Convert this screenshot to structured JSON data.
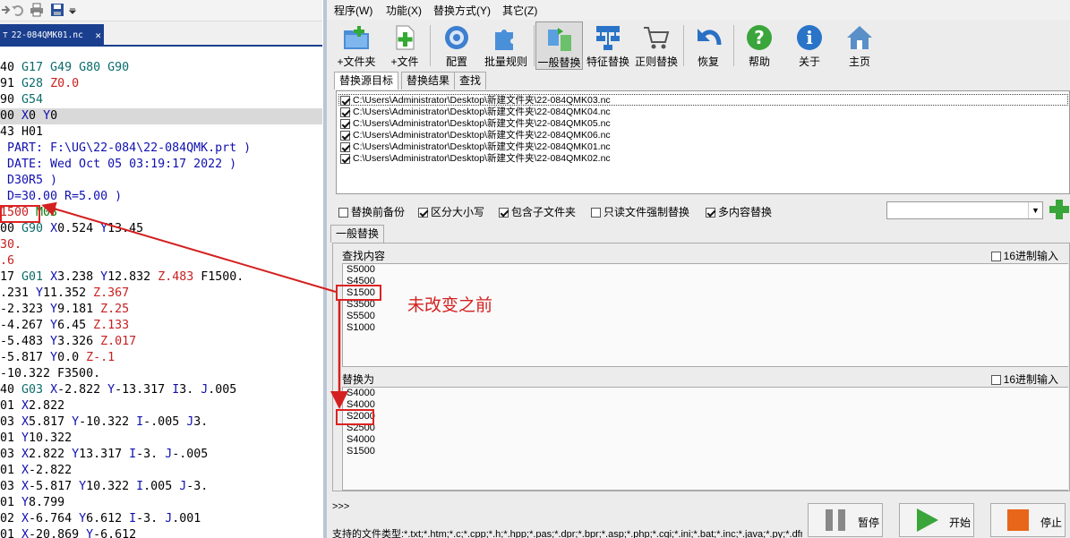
{
  "editor": {
    "tab_title": "22-084QMK01.nc",
    "lines": [
      [
        [
          "40 ",
          "d"
        ],
        [
          "G17 G49 G80 G90",
          "k"
        ]
      ],
      [
        [
          "91 ",
          "d"
        ],
        [
          "G28 ",
          "k"
        ],
        [
          "Z0.0",
          "r"
        ]
      ],
      [
        [
          "90 ",
          "d"
        ],
        [
          "G54",
          "k"
        ]
      ],
      [
        [
          "00 ",
          "d"
        ],
        [
          "X",
          "b"
        ],
        [
          "0 ",
          "d"
        ],
        [
          "Y",
          "b"
        ],
        [
          "0",
          "d"
        ]
      ],
      [
        [
          "43 H01",
          "d"
        ]
      ],
      [
        [
          " PART: F:\\UG\\22-084\\22-084QMK.prt )",
          "b"
        ]
      ],
      [
        [
          " DATE: Wed Oct 05 03:19:17 2022 )",
          "b"
        ]
      ],
      [
        [
          " D30R5 )",
          "b"
        ]
      ],
      [
        [
          " D=30.00 R=5.00 )",
          "b"
        ]
      ],
      [
        [
          "1500 ",
          "r"
        ],
        [
          "M03",
          "g"
        ]
      ],
      [
        [
          "00 ",
          "d"
        ],
        [
          "G90 ",
          "k"
        ],
        [
          "X",
          "b"
        ],
        [
          "0.524 ",
          "d"
        ],
        [
          "Y",
          "b"
        ],
        [
          "13.45",
          "d"
        ]
      ],
      [
        [
          "30.",
          "r"
        ]
      ],
      [
        [
          ".6",
          "r"
        ]
      ],
      [
        [
          "17 ",
          "d"
        ],
        [
          "G01 ",
          "k"
        ],
        [
          "X",
          "b"
        ],
        [
          "3.238 ",
          "d"
        ],
        [
          "Y",
          "b"
        ],
        [
          "12.832 ",
          "d"
        ],
        [
          "Z.483 ",
          "r"
        ],
        [
          "F1500.",
          "d"
        ]
      ],
      [
        [
          ".231 ",
          "d"
        ],
        [
          "Y",
          "b"
        ],
        [
          "11.352 ",
          "d"
        ],
        [
          "Z.367",
          "r"
        ]
      ],
      [
        [
          "-2.323 ",
          "d"
        ],
        [
          "Y",
          "b"
        ],
        [
          "9.181 ",
          "d"
        ],
        [
          "Z.25",
          "r"
        ]
      ],
      [
        [
          "-4.267 ",
          "d"
        ],
        [
          "Y",
          "b"
        ],
        [
          "6.45 ",
          "d"
        ],
        [
          "Z.133",
          "r"
        ]
      ],
      [
        [
          "-5.483 ",
          "d"
        ],
        [
          "Y",
          "b"
        ],
        [
          "3.326 ",
          "d"
        ],
        [
          "Z.017",
          "r"
        ]
      ],
      [
        [
          "-5.817 ",
          "d"
        ],
        [
          "Y",
          "b"
        ],
        [
          "0.0 ",
          "d"
        ],
        [
          "Z-.1",
          "r"
        ]
      ],
      [
        [
          "-10.322 F3500.",
          "d"
        ]
      ],
      [
        [
          "40 ",
          "d"
        ],
        [
          "G03 ",
          "k"
        ],
        [
          "X",
          "b"
        ],
        [
          "-2.822 ",
          "d"
        ],
        [
          "Y",
          "b"
        ],
        [
          "-13.317 ",
          "d"
        ],
        [
          "I",
          "b"
        ],
        [
          "3. ",
          "d"
        ],
        [
          "J",
          "b"
        ],
        [
          ".005",
          "d"
        ]
      ],
      [
        [
          "01 ",
          "d"
        ],
        [
          "X",
          "b"
        ],
        [
          "2.822",
          "d"
        ]
      ],
      [
        [
          "03 ",
          "d"
        ],
        [
          "X",
          "b"
        ],
        [
          "5.817 ",
          "d"
        ],
        [
          "Y",
          "b"
        ],
        [
          "-10.322 ",
          "d"
        ],
        [
          "I",
          "b"
        ],
        [
          "-.005 ",
          "d"
        ],
        [
          "J",
          "b"
        ],
        [
          "3.",
          "d"
        ]
      ],
      [
        [
          "01 ",
          "d"
        ],
        [
          "Y",
          "b"
        ],
        [
          "10.322",
          "d"
        ]
      ],
      [
        [
          "03 ",
          "d"
        ],
        [
          "X",
          "b"
        ],
        [
          "2.822 ",
          "d"
        ],
        [
          "Y",
          "b"
        ],
        [
          "13.317 ",
          "d"
        ],
        [
          "I",
          "b"
        ],
        [
          "-3. ",
          "d"
        ],
        [
          "J",
          "b"
        ],
        [
          "-.005",
          "d"
        ]
      ],
      [
        [
          "01 ",
          "d"
        ],
        [
          "X",
          "b"
        ],
        [
          "-2.822",
          "d"
        ]
      ],
      [
        [
          "03 ",
          "d"
        ],
        [
          "X",
          "b"
        ],
        [
          "-5.817 ",
          "d"
        ],
        [
          "Y",
          "b"
        ],
        [
          "10.322 ",
          "d"
        ],
        [
          "I",
          "b"
        ],
        [
          ".005 ",
          "d"
        ],
        [
          "J",
          "b"
        ],
        [
          "-3.",
          "d"
        ]
      ],
      [
        [
          "01 ",
          "d"
        ],
        [
          "Y",
          "b"
        ],
        [
          "8.799",
          "d"
        ]
      ],
      [
        [
          "02 ",
          "d"
        ],
        [
          "X",
          "b"
        ],
        [
          "-6.764 ",
          "d"
        ],
        [
          "Y",
          "b"
        ],
        [
          "6.612 ",
          "d"
        ],
        [
          "I",
          "b"
        ],
        [
          "-3. ",
          "d"
        ],
        [
          "J",
          "b"
        ],
        [
          ".001",
          "d"
        ]
      ],
      [
        [
          "01 ",
          "d"
        ],
        [
          "X",
          "b"
        ],
        [
          "-20.869 ",
          "d"
        ],
        [
          "Y",
          "b"
        ],
        [
          "-6.612",
          "d"
        ]
      ]
    ]
  },
  "menu": [
    "程序(W)",
    "功能(X)",
    "替换方式(Y)",
    "其它(Z)"
  ],
  "toolbar": [
    "+文件夹",
    "+文件",
    "配置",
    "批量规则",
    "一般替换",
    "特征替换",
    "正则替换",
    "恢复",
    "帮助",
    "关于",
    "主页"
  ],
  "source_tabs": [
    "替换源目标",
    "替换结果",
    "查找"
  ],
  "files": [
    "C:\\Users\\Administrator\\Desktop\\新建文件夹\\22-084QMK03.nc",
    "C:\\Users\\Administrator\\Desktop\\新建文件夹\\22-084QMK04.nc",
    "C:\\Users\\Administrator\\Desktop\\新建文件夹\\22-084QMK05.nc",
    "C:\\Users\\Administrator\\Desktop\\新建文件夹\\22-084QMK06.nc",
    "C:\\Users\\Administrator\\Desktop\\新建文件夹\\22-084QMK01.nc",
    "C:\\Users\\Administrator\\Desktop\\新建文件夹\\22-084QMK02.nc"
  ],
  "options": [
    {
      "label": "替换前备份",
      "checked": false
    },
    {
      "label": "区分大小写",
      "checked": true
    },
    {
      "label": "包含子文件夹",
      "checked": true
    },
    {
      "label": "只读文件强制替换",
      "checked": false
    },
    {
      "label": "多内容替换",
      "checked": true
    }
  ],
  "mode_tab": "一般替换",
  "find": {
    "label": "查找内容",
    "hex_label": "16进制输入",
    "lines": [
      "S5000",
      "S4500",
      "S1500",
      "S3500",
      "S5500",
      "S1000"
    ]
  },
  "replace": {
    "label": "替换为",
    "hex_label": "16进制输入",
    "lines": [
      "S4000",
      "S4000",
      "S2000",
      "S2500",
      "S4000",
      "S1500"
    ]
  },
  "annotation": "未改变之前",
  "prompt": ">>>",
  "status": "支持的文件类型:*.txt;*.htm;*.c;*.cpp;*.h;*.hpp;*.pas;*.dpr;*.bpr;*.asp;*.php;*.cgi;*.ini;*.bat;*.inc;*.java;*.py;*.dfm",
  "buttons": {
    "pause": "暂停",
    "start": "开始",
    "stop": "停止"
  },
  "colors": {
    "editor_tab": "#1b3f8f",
    "annotation": "#d42020",
    "highlight_box": "#d22222"
  }
}
